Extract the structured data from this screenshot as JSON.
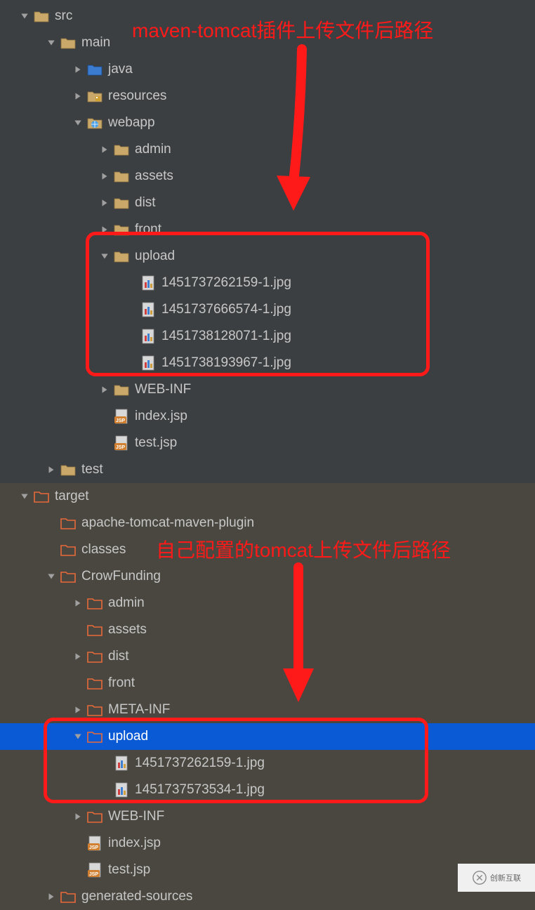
{
  "annotations": {
    "top": "maven-tomcat插件上传文件后路径",
    "bottom": "自己配置的tomcat上传文件后路径"
  },
  "tree": [
    {
      "indent": 0,
      "arrow": "down",
      "icon": "folder-tan",
      "label": "src"
    },
    {
      "indent": 1,
      "arrow": "down",
      "icon": "folder-tan",
      "label": "main"
    },
    {
      "indent": 2,
      "arrow": "right",
      "icon": "folder-blue",
      "label": "java"
    },
    {
      "indent": 2,
      "arrow": "right",
      "icon": "folder-resources",
      "label": "resources"
    },
    {
      "indent": 2,
      "arrow": "down",
      "icon": "folder-webapp",
      "label": "webapp"
    },
    {
      "indent": 3,
      "arrow": "right",
      "icon": "folder-tan",
      "label": "admin"
    },
    {
      "indent": 3,
      "arrow": "right",
      "icon": "folder-tan",
      "label": "assets"
    },
    {
      "indent": 3,
      "arrow": "right",
      "icon": "folder-tan",
      "label": "dist"
    },
    {
      "indent": 3,
      "arrow": "right",
      "icon": "folder-tan",
      "label": "front"
    },
    {
      "indent": 3,
      "arrow": "down",
      "icon": "folder-tan",
      "label": "upload"
    },
    {
      "indent": 4,
      "arrow": "none",
      "icon": "image",
      "label": "1451737262159-1.jpg"
    },
    {
      "indent": 4,
      "arrow": "none",
      "icon": "image",
      "label": "1451737666574-1.jpg"
    },
    {
      "indent": 4,
      "arrow": "none",
      "icon": "image",
      "label": "1451738128071-1.jpg"
    },
    {
      "indent": 4,
      "arrow": "none",
      "icon": "image",
      "label": "1451738193967-1.jpg"
    },
    {
      "indent": 3,
      "arrow": "right",
      "icon": "folder-tan",
      "label": "WEB-INF"
    },
    {
      "indent": 3,
      "arrow": "none",
      "icon": "jsp",
      "label": "index.jsp"
    },
    {
      "indent": 3,
      "arrow": "none",
      "icon": "jsp",
      "label": "test.jsp"
    },
    {
      "indent": 1,
      "arrow": "right",
      "icon": "folder-tan",
      "label": "test"
    },
    {
      "indent": 0,
      "arrow": "down",
      "icon": "folder-orange",
      "label": "target",
      "section": "target"
    },
    {
      "indent": 1,
      "arrow": "none",
      "icon": "folder-orange",
      "label": "apache-tomcat-maven-plugin",
      "section": "target"
    },
    {
      "indent": 1,
      "arrow": "none",
      "icon": "folder-orange",
      "label": "classes",
      "section": "target"
    },
    {
      "indent": 1,
      "arrow": "down",
      "icon": "folder-orange",
      "label": "CrowFunding",
      "section": "target"
    },
    {
      "indent": 2,
      "arrow": "right",
      "icon": "folder-orange",
      "label": "admin",
      "section": "target"
    },
    {
      "indent": 2,
      "arrow": "none",
      "icon": "folder-orange",
      "label": "assets",
      "section": "target"
    },
    {
      "indent": 2,
      "arrow": "right",
      "icon": "folder-orange",
      "label": "dist",
      "section": "target"
    },
    {
      "indent": 2,
      "arrow": "none",
      "icon": "folder-orange",
      "label": "front",
      "section": "target"
    },
    {
      "indent": 2,
      "arrow": "right",
      "icon": "folder-orange",
      "label": "META-INF",
      "section": "target"
    },
    {
      "indent": 2,
      "arrow": "down",
      "icon": "folder-orange",
      "label": "upload",
      "section": "target",
      "selected": true
    },
    {
      "indent": 3,
      "arrow": "none",
      "icon": "image",
      "label": "1451737262159-1.jpg",
      "section": "target"
    },
    {
      "indent": 3,
      "arrow": "none",
      "icon": "image",
      "label": "1451737573534-1.jpg",
      "section": "target"
    },
    {
      "indent": 2,
      "arrow": "right",
      "icon": "folder-orange",
      "label": "WEB-INF",
      "section": "target"
    },
    {
      "indent": 2,
      "arrow": "none",
      "icon": "jsp",
      "label": "index.jsp",
      "section": "target"
    },
    {
      "indent": 2,
      "arrow": "none",
      "icon": "jsp",
      "label": "test.jsp",
      "section": "target"
    },
    {
      "indent": 1,
      "arrow": "right",
      "icon": "folder-orange",
      "label": "generated-sources",
      "section": "target"
    }
  ],
  "watermark": "创新互联"
}
